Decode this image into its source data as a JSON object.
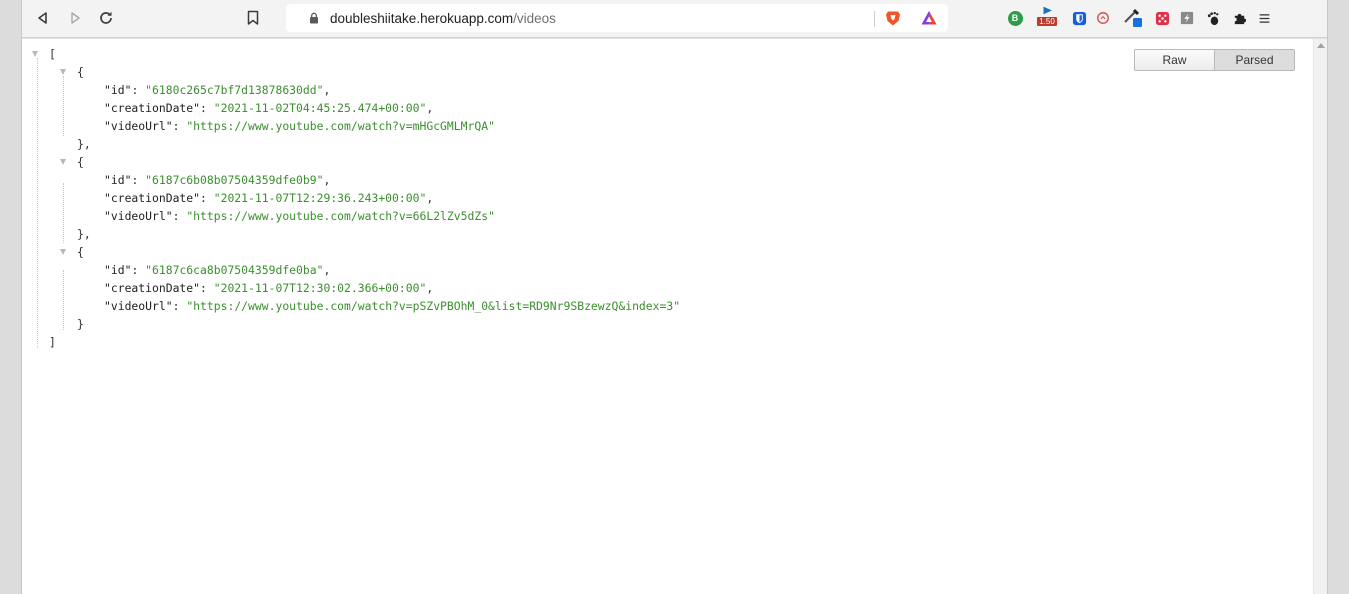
{
  "browser": {
    "url_host": "doubleshiitake.herokuapp.com",
    "url_path": "/videos",
    "extensions": [
      {
        "name": "b-extension-icon",
        "color": "#2e9b4a",
        "label": "B"
      },
      {
        "name": "video-speed-icon",
        "badge": "1.50"
      },
      {
        "name": "bitwarden-icon",
        "color": "#175ddc"
      },
      {
        "name": "timer-icon",
        "color": "#d9534f"
      },
      {
        "name": "eyedropper-icon"
      },
      {
        "name": "dice-icon",
        "color": "#e0314b"
      },
      {
        "name": "zap-icon"
      },
      {
        "name": "gnome-foot-icon"
      },
      {
        "name": "puzzle-icon"
      },
      {
        "name": "menu-icon"
      }
    ]
  },
  "viewer": {
    "raw_label": "Raw",
    "parsed_label": "Parsed",
    "open_bracket": "[",
    "close_bracket": "]",
    "items": [
      {
        "id": "6180c265c7bf7d13878630dd",
        "creationDate": "2021-11-02T04:45:25.474+00:00",
        "videoUrl": "https://www.youtube.com/watch?v=mHGcGMLMrQA"
      },
      {
        "id": "6187c6b08b07504359dfe0b9",
        "creationDate": "2021-11-07T12:29:36.243+00:00",
        "videoUrl": "https://www.youtube.com/watch?v=66L2lZv5dZs"
      },
      {
        "id": "6187c6ca8b07504359dfe0ba",
        "creationDate": "2021-11-07T12:30:02.366+00:00",
        "videoUrl": "https://www.youtube.com/watch?v=pSZvPBOhM_0&list=RD9Nr9SBzewzQ&index=3"
      }
    ],
    "keys": {
      "id": "id",
      "creationDate": "creationDate",
      "videoUrl": "videoUrl"
    }
  }
}
